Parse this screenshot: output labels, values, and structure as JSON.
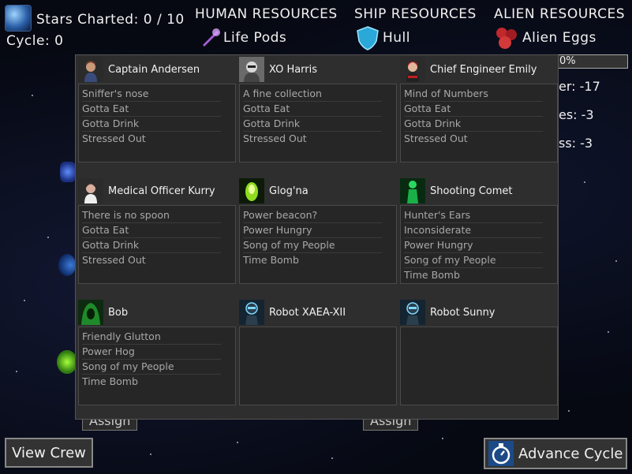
{
  "hud": {
    "stars_charted": "Stars Charted: 0 / 10",
    "cycle": "Cycle: 0"
  },
  "resource_headers": {
    "human": "HUMAN RESOURCES",
    "ship": "SHIP RESOURCES",
    "alien": "ALIEN RESOURCES"
  },
  "resources": {
    "life_pods": "Life Pods",
    "hull": "Hull",
    "alien_eggs": "Alien Eggs"
  },
  "progress": {
    "label": "0%",
    "value": 0
  },
  "side_stats": [
    "er: -17",
    "es: -3",
    "ss: -3"
  ],
  "background_buttons": [
    "Assign",
    "Assign"
  ],
  "buttons": {
    "view_crew": "View Crew",
    "advance_cycle": "Advance Cycle"
  },
  "crew": [
    {
      "name": "Captain Andersen",
      "portrait": "human-captain-portrait",
      "traits": [
        "Sniffer's nose",
        "Gotta Eat",
        "Gotta Drink",
        "Stressed Out"
      ]
    },
    {
      "name": "XO Harris",
      "portrait": "human-xo-portrait",
      "traits": [
        "A fine collection",
        "Gotta Eat",
        "Gotta Drink",
        "Stressed Out"
      ]
    },
    {
      "name": "Chief Engineer Emily",
      "portrait": "human-engineer-portrait",
      "traits": [
        "Mind of Numbers",
        "Gotta Eat",
        "Gotta Drink",
        "Stressed Out"
      ]
    },
    {
      "name": "Medical Officer Kurry",
      "portrait": "human-medic-portrait",
      "traits": [
        "There is no spoon",
        "Gotta Eat",
        "Gotta Drink",
        "Stressed Out"
      ]
    },
    {
      "name": "Glog'na",
      "portrait": "alien-glowing-portrait",
      "traits": [
        "Power beacon?",
        "Power Hungry",
        "Song of my People",
        "Time Bomb"
      ]
    },
    {
      "name": "Shooting Comet",
      "portrait": "alien-green-figure-portrait",
      "traits": [
        "Hunter's Ears",
        "Inconsiderate",
        "Power Hungry",
        "Song of my People",
        "Time Bomb"
      ]
    },
    {
      "name": "Bob",
      "portrait": "alien-hooded-portrait",
      "traits": [
        "Friendly Glutton",
        "Power Hog",
        "Song of my People",
        "Time Bomb"
      ]
    },
    {
      "name": "Robot XAEA-XII",
      "portrait": "robot-portrait",
      "traits": []
    },
    {
      "name": "Robot Sunny",
      "portrait": "robot-portrait",
      "traits": []
    }
  ],
  "colors": {
    "panel_bg": "#2e2e2e",
    "trait_text": "#a8a8a8",
    "hull_icon": "#2aa8d8",
    "egg_icon": "#c0282c",
    "pod_icon": "#a45cd6"
  }
}
